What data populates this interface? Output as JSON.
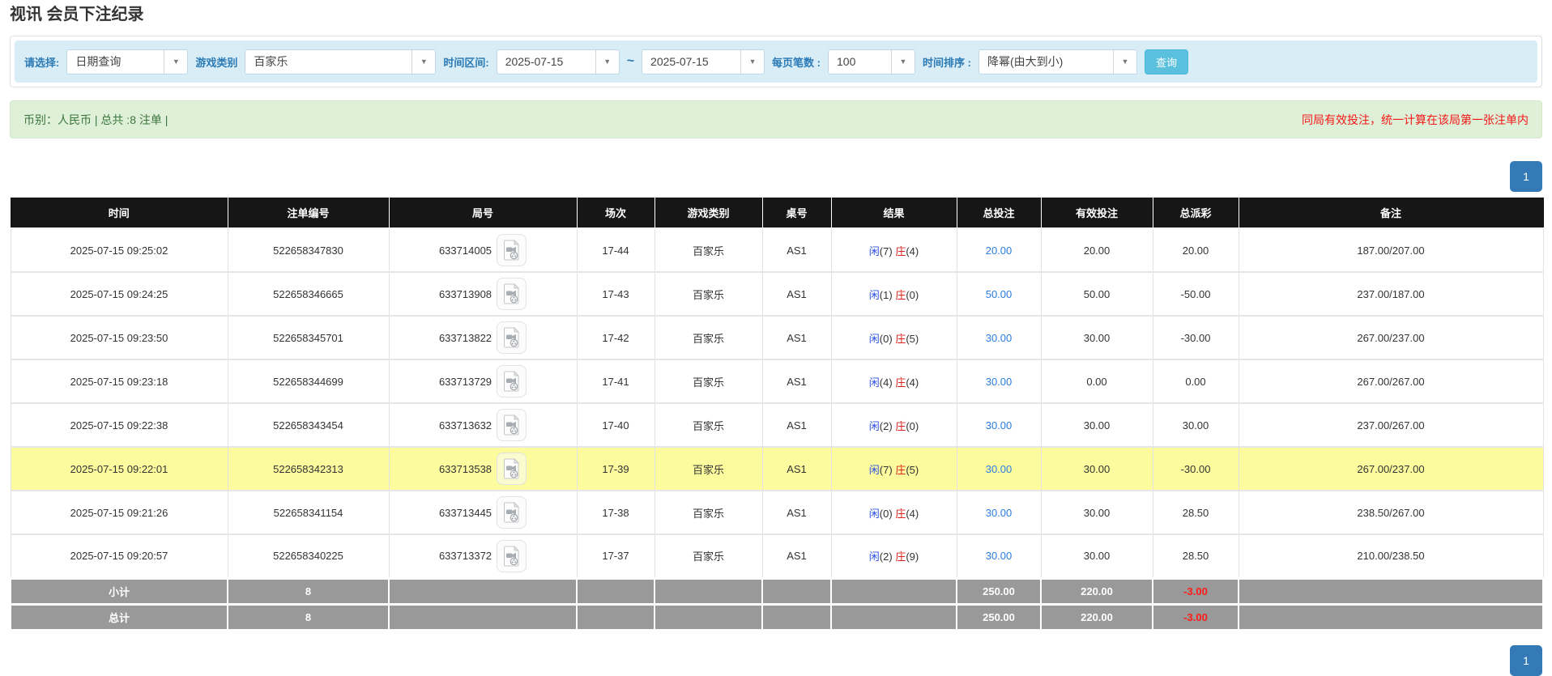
{
  "page": {
    "title": "视讯 会员下注纪录"
  },
  "filters": {
    "select_label": "请选择:",
    "select_value": "日期查询",
    "game_label": "游戏类别",
    "game_value": "百家乐",
    "range_label": "时间区间:",
    "range_start": "2025-07-15",
    "range_separator": "~",
    "range_end": "2025-07-15",
    "per_page_label": "每页笔数 :",
    "per_page_value": "100",
    "sort_label": "时间排序 :",
    "sort_value": "降幂(由大到小)",
    "search_button": "查询",
    "dropdown_arrow": "▼"
  },
  "summary": {
    "left": "币别：人民币 | 总共 :8 注单 |",
    "right_notice": "同局有效投注，统一计算在该局第一张注单内"
  },
  "pagination": {
    "page": "1"
  },
  "icons": {
    "round_icon": "video-replay-file-icon"
  },
  "colors": {
    "label_blue": "#2a7ab5",
    "link_blue": "#2a7ce2",
    "player_blue": "#2c50e2",
    "banker_red": "#d9251d",
    "negative_red": "#f41818",
    "highlight_yellow": "#fcfc9e",
    "pager_blue": "#337ab7",
    "search_btn_blue": "#5bc0de",
    "header_black": "#161616",
    "summary_green_bg": "#dff0d8",
    "filter_bar_blue_bg": "#d9edf7",
    "footer_gray": "#999999"
  },
  "table": {
    "columns": [
      "时间",
      "注单编号",
      "局号",
      "场次",
      "游戏类别",
      "桌号",
      "结果",
      "总投注",
      "有效投注",
      "总派彩",
      "备注"
    ],
    "result_labels": {
      "player": "闲",
      "banker": "庄"
    },
    "rows": [
      {
        "time": "2025-07-15 09:25:02",
        "bet_id": "522658347830",
        "round": "633714005",
        "session": "17-44",
        "game": "百家乐",
        "table_no": "AS1",
        "result": {
          "player": "7",
          "banker": "4"
        },
        "total_bet": "20.00",
        "valid_bet": "20.00",
        "payout": "20.00",
        "note": "187.00/207.00",
        "highlight": false
      },
      {
        "time": "2025-07-15 09:24:25",
        "bet_id": "522658346665",
        "round": "633713908",
        "session": "17-43",
        "game": "百家乐",
        "table_no": "AS1",
        "result": {
          "player": "1",
          "banker": "0"
        },
        "total_bet": "50.00",
        "valid_bet": "50.00",
        "payout": "-50.00",
        "note": "237.00/187.00",
        "highlight": false
      },
      {
        "time": "2025-07-15 09:23:50",
        "bet_id": "522658345701",
        "round": "633713822",
        "session": "17-42",
        "game": "百家乐",
        "table_no": "AS1",
        "result": {
          "player": "0",
          "banker": "5"
        },
        "total_bet": "30.00",
        "valid_bet": "30.00",
        "payout": "-30.00",
        "note": "267.00/237.00",
        "highlight": false
      },
      {
        "time": "2025-07-15 09:23:18",
        "bet_id": "522658344699",
        "round": "633713729",
        "session": "17-41",
        "game": "百家乐",
        "table_no": "AS1",
        "result": {
          "player": "4",
          "banker": "4"
        },
        "total_bet": "30.00",
        "valid_bet": "0.00",
        "payout": "0.00",
        "note": "267.00/267.00",
        "highlight": false
      },
      {
        "time": "2025-07-15 09:22:38",
        "bet_id": "522658343454",
        "round": "633713632",
        "session": "17-40",
        "game": "百家乐",
        "table_no": "AS1",
        "result": {
          "player": "2",
          "banker": "0"
        },
        "total_bet": "30.00",
        "valid_bet": "30.00",
        "payout": "30.00",
        "note": "237.00/267.00",
        "highlight": false
      },
      {
        "time": "2025-07-15 09:22:01",
        "bet_id": "522658342313",
        "round": "633713538",
        "session": "17-39",
        "game": "百家乐",
        "table_no": "AS1",
        "result": {
          "player": "7",
          "banker": "5"
        },
        "total_bet": "30.00",
        "valid_bet": "30.00",
        "payout": "-30.00",
        "note": "267.00/237.00",
        "highlight": true
      },
      {
        "time": "2025-07-15 09:21:26",
        "bet_id": "522658341154",
        "round": "633713445",
        "session": "17-38",
        "game": "百家乐",
        "table_no": "AS1",
        "result": {
          "player": "0",
          "banker": "4"
        },
        "total_bet": "30.00",
        "valid_bet": "30.00",
        "payout": "28.50",
        "note": "238.50/267.00",
        "highlight": false
      },
      {
        "time": "2025-07-15 09:20:57",
        "bet_id": "522658340225",
        "round": "633713372",
        "session": "17-37",
        "game": "百家乐",
        "table_no": "AS1",
        "result": {
          "player": "2",
          "banker": "9"
        },
        "total_bet": "30.00",
        "valid_bet": "30.00",
        "payout": "28.50",
        "note": "210.00/238.50",
        "highlight": false
      }
    ],
    "footer": [
      {
        "label": "小计",
        "count": "8",
        "total_bet": "250.00",
        "valid_bet": "220.00",
        "payout": "-3.00"
      },
      {
        "label": "总计",
        "count": "8",
        "total_bet": "250.00",
        "valid_bet": "220.00",
        "payout": "-3.00"
      }
    ]
  }
}
